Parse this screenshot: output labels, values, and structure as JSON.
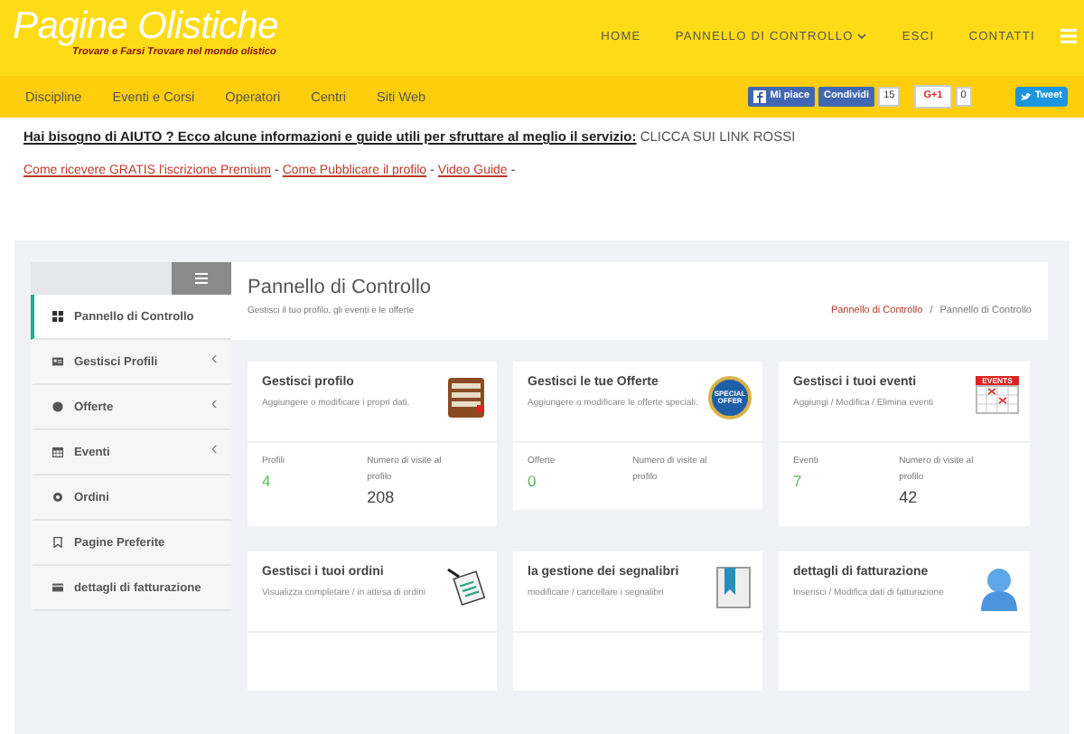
{
  "header": {
    "logo": "Pagine Olistiche",
    "tagline": "Trovare e Farsi Trovare nel mondo olistico",
    "nav": [
      {
        "label": "HOME",
        "dropdown": false
      },
      {
        "label": "PANNELLO DI CONTROLLO",
        "dropdown": true
      },
      {
        "label": "ESCI",
        "dropdown": false
      },
      {
        "label": "CONTATTI",
        "dropdown": false
      }
    ]
  },
  "subnav": [
    "Discipline",
    "Eventi e Corsi",
    "Operatori",
    "Centri",
    "Siti Web"
  ],
  "social": [
    {
      "kind": "facebook",
      "label": "Mi piace"
    },
    {
      "kind": "share",
      "label": "Condividi"
    },
    {
      "kind": "count",
      "label": "15"
    },
    {
      "kind": "gplus",
      "label": "G+1"
    },
    {
      "kind": "count",
      "label": "0"
    },
    {
      "kind": "twitter",
      "label": "Tweet"
    }
  ],
  "help": {
    "heading": "**Hai bisogno di AIUTO ? Ecco alcune informazioni e guide utili per sfruttare al meglio il servizio:** CLICCA SUI LINK ROSSI",
    "links": [
      {
        "kind": "link",
        "label": "Come ricevere GRATIS l'iscrizione Premium"
      },
      {
        "kind": "text",
        "label": "-"
      },
      {
        "kind": "link",
        "label": "Come Pubblicare il profilo"
      },
      {
        "kind": "text",
        "label": "-"
      },
      {
        "kind": "link",
        "label": "Video Guide"
      },
      {
        "kind": "text",
        "label": "-"
      }
    ]
  },
  "sidebar": {
    "items": [
      {
        "label": "Pannello di Controllo",
        "selected": true,
        "expandable": false
      },
      {
        "label": "Gestisci Profili",
        "selected": false,
        "expandable": true
      },
      {
        "label": "Offerte",
        "selected": false,
        "expandable": true
      },
      {
        "label": "Eventi",
        "selected": false,
        "expandable": true
      },
      {
        "label": "Ordini",
        "selected": false,
        "expandable": false
      },
      {
        "label": "Pagine Preferite",
        "selected": false,
        "expandable": false
      },
      {
        "label": "dettagli di fatturazione",
        "selected": false,
        "expandable": false
      }
    ]
  },
  "panel": {
    "title": "Pannello di Controllo",
    "subtitle": "Gestisci il tuo profilo, gli eventi e le offerte",
    "breadcrumb": [
      {
        "kind": "link",
        "label": "Pannello di Controllo"
      },
      {
        "kind": "separator",
        "label": "/"
      },
      {
        "kind": "current",
        "label": "Pannello di Controllo"
      }
    ]
  },
  "cards": [
    {
      "title": "Gestisci profilo",
      "description": "Aggiungere o modificare i propri dati.",
      "stats": [
        {
          "label": "Profili",
          "value": "4",
          "kind": "count"
        },
        {
          "label": "Numero di visite al profilo",
          "value": "208",
          "kind": "visits"
        }
      ]
    },
    {
      "title": "Gestisci le tue Offerte",
      "description": "Aggiungere o modificare le offerte speciali.",
      "icon_text": "SPECIAL OFFER",
      "stats": [
        {
          "label": "Offerte",
          "value": "0",
          "kind": "count"
        },
        {
          "label": "Numero di visite al profilo",
          "kind": "visits"
        }
      ]
    },
    {
      "title": "Gestisci i tuoi eventi",
      "description": "Aggiungi / Modifica / Elimina eventi",
      "icon_text": "EVENTS",
      "stats": [
        {
          "label": "Eventi",
          "value": "7",
          "kind": "count"
        },
        {
          "label": "Numero di visite al profilo",
          "value": "42",
          "kind": "visits"
        }
      ]
    },
    {
      "title": "Gestisci i tuoi ordini",
      "description": "Visualizza completare / in attesa di ordini"
    },
    {
      "title": "la gestione dei segnalibri",
      "description": "modificare / cancellare i segnalibri"
    },
    {
      "title": "dettagli di fatturazione",
      "description": "Inserisci / Modifica dati di fatturazione"
    }
  ]
}
